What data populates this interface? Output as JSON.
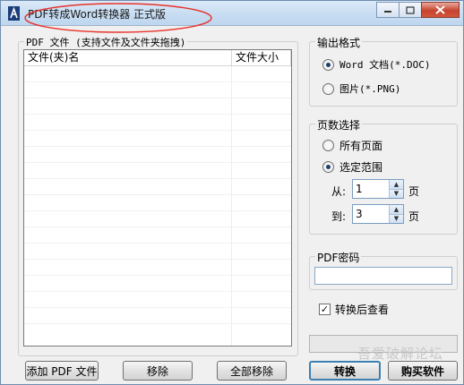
{
  "window": {
    "title": "PDF转成Word转换器 正式版",
    "controls": {
      "minimize": "minimize",
      "maximize": "maximize",
      "close": "close"
    }
  },
  "file_panel": {
    "legend": "PDF 文件 (支持文件及文件夹拖拽)",
    "columns": [
      "文件(夹)名",
      "文件大小"
    ],
    "rows": [],
    "buttons": {
      "add": "添加 PDF 文件",
      "remove": "移除",
      "remove_all": "全部移除"
    }
  },
  "output_format": {
    "legend": "输出格式",
    "options": [
      {
        "label": "Word 文档(*.DOC)",
        "selected": true
      },
      {
        "label": "图片(*.PNG)",
        "selected": false
      }
    ]
  },
  "page_selection": {
    "legend": "页数选择",
    "options": [
      {
        "label": "所有页面",
        "selected": false
      },
      {
        "label": "选定范围",
        "selected": true
      }
    ],
    "from_label": "从:",
    "from_value": "1",
    "to_label": "到:",
    "to_value": "3",
    "page_unit": "页"
  },
  "pdf_password": {
    "legend": "PDF密码",
    "value": ""
  },
  "convert_then_view": {
    "label": "转换后查看",
    "checked": true
  },
  "actions": {
    "convert": "转换",
    "buy": "购买软件"
  },
  "watermark": "吾爱破解论坛",
  "colors": {
    "annotation_ellipse": "#e8322c",
    "title_bar": "#c6dcf2"
  }
}
